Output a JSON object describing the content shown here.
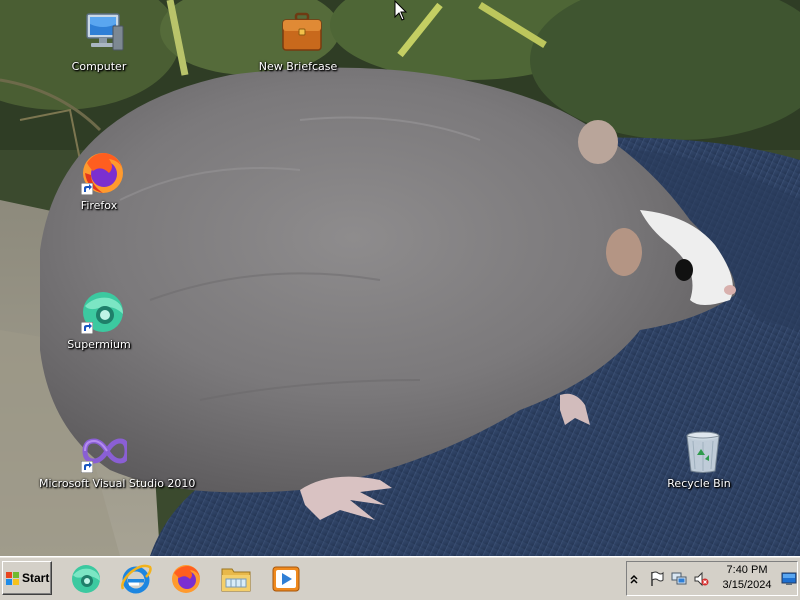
{
  "desktop": {
    "icons": [
      {
        "label": "Computer",
        "icon": "computer-icon"
      },
      {
        "label": "New Briefcase",
        "icon": "briefcase-icon"
      },
      {
        "label": "Firefox",
        "icon": "firefox-icon"
      },
      {
        "label": "Supermium",
        "icon": "supermium-icon"
      },
      {
        "label": "Microsoft Visual Studio 2010",
        "icon": "visual-studio-icon"
      },
      {
        "label": "Recycle Bin",
        "icon": "recycle-bin-icon"
      }
    ]
  },
  "taskbar": {
    "start_label": "Start",
    "pinned": [
      {
        "icon": "supermium-icon"
      },
      {
        "icon": "internet-explorer-icon"
      },
      {
        "icon": "firefox-icon"
      },
      {
        "icon": "file-explorer-icon"
      },
      {
        "icon": "media-player-icon"
      }
    ],
    "tray": {
      "icons": [
        "show-hidden-icons-chevron",
        "action-center-flag-icon",
        "network-icon",
        "volume-muted-icon"
      ],
      "time": "7:40 PM",
      "date": "3/15/2024"
    }
  },
  "colors": {
    "taskbar": "#d4d0c8",
    "label_text": "#ffffff"
  }
}
